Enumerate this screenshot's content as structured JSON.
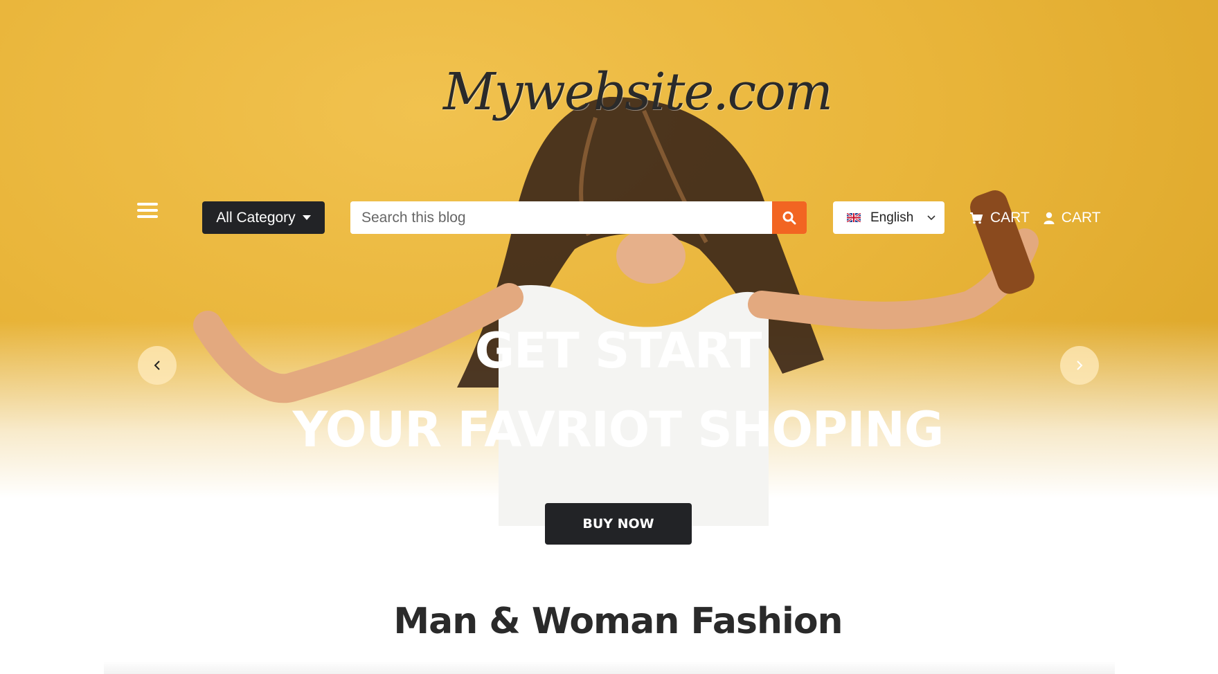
{
  "header": {
    "logo_text": "Mywebsite.com",
    "category_label": "All Category",
    "search": {
      "placeholder": "Search this blog"
    },
    "language": {
      "selected": "English"
    },
    "cart_links": [
      {
        "label": "CART",
        "icon": "cart-icon"
      },
      {
        "label": "CART",
        "icon": "user-icon"
      }
    ]
  },
  "hero": {
    "headline_line1": "GET START",
    "headline_line2": "YOUR FAVRIOT SHOPING",
    "cta_label": "BUY NOW"
  },
  "section": {
    "title": "Man & Woman Fashion"
  },
  "colors": {
    "hero_background": "#e9b53a",
    "search_button": "#f26522",
    "dark_button": "#222326",
    "title_text": "#2a2a2a"
  }
}
